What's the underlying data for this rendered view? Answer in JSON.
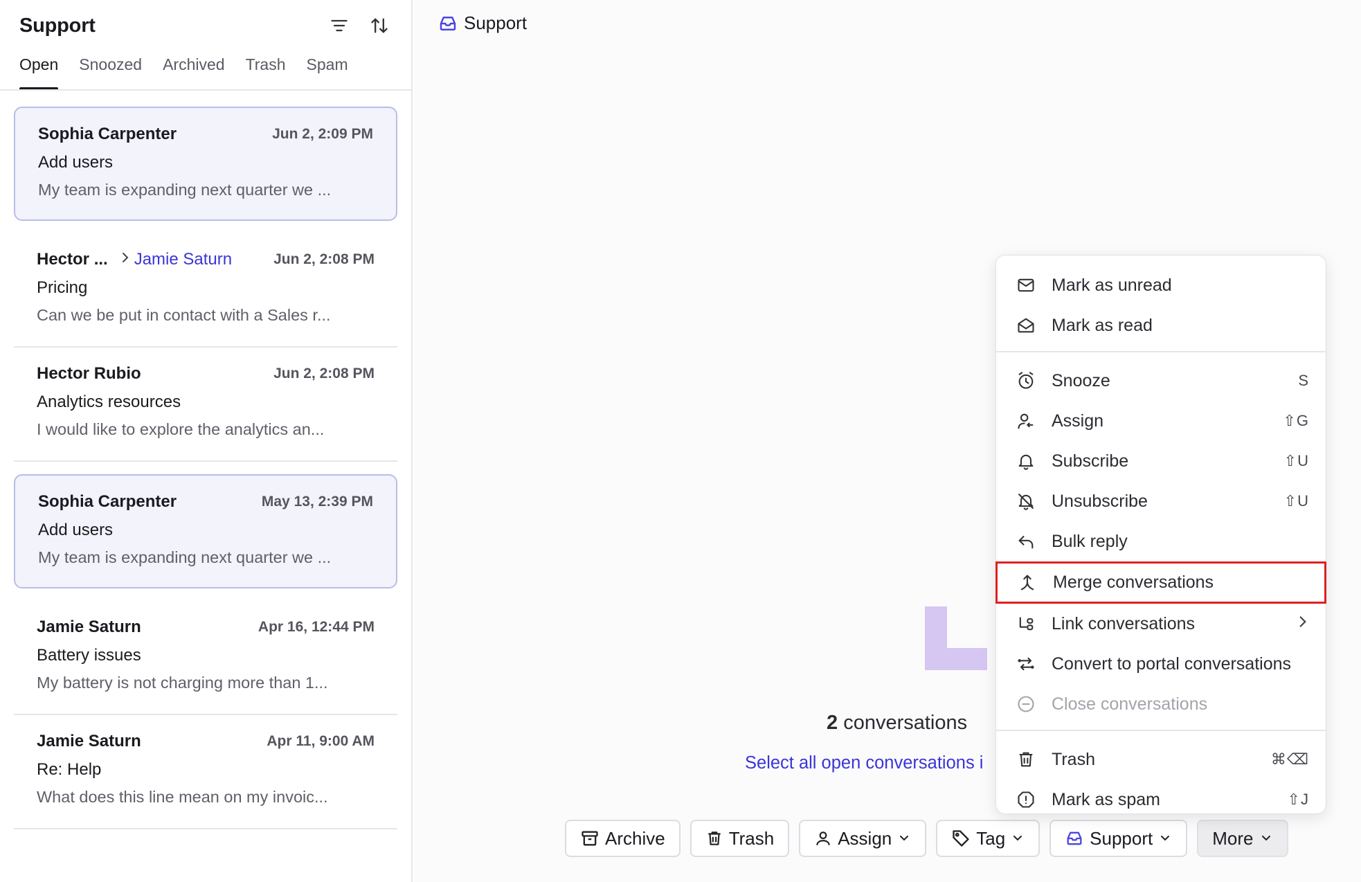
{
  "sidebar": {
    "title": "Support",
    "tabs": [
      {
        "label": "Open",
        "active": true
      },
      {
        "label": "Snoozed"
      },
      {
        "label": "Archived"
      },
      {
        "label": "Trash"
      },
      {
        "label": "Spam"
      }
    ],
    "conversations": [
      {
        "name": "Sophia Carpenter",
        "assignee": "",
        "date": "Jun 2, 2:09 PM",
        "subject": "Add users",
        "preview": "My team is expanding next quarter we ...",
        "selected": true
      },
      {
        "name": "Hector ...",
        "assignee": "Jamie Saturn",
        "date": "Jun 2, 2:08 PM",
        "subject": "Pricing",
        "preview": "Can we be put in contact with a Sales r...",
        "selected": false
      },
      {
        "name": "Hector Rubio",
        "assignee": "",
        "date": "Jun 2, 2:08 PM",
        "subject": "Analytics resources",
        "preview": "I would like to explore the analytics an...",
        "selected": false
      },
      {
        "name": "Sophia Carpenter",
        "assignee": "",
        "date": "May 13, 2:39 PM",
        "subject": "Add users",
        "preview": "My team is expanding next quarter we ...",
        "selected": true
      },
      {
        "name": "Jamie Saturn",
        "assignee": "",
        "date": "Apr 16, 12:44 PM",
        "subject": "Battery issues",
        "preview": "My battery is not charging more than 1...",
        "selected": false
      },
      {
        "name": "Jamie Saturn",
        "assignee": "",
        "date": "Apr 11, 9:00 AM",
        "subject": "Re: Help",
        "preview": "What does this line mean on my invoic...",
        "selected": false
      }
    ]
  },
  "main": {
    "title": "Support",
    "selection": {
      "count": "2",
      "text": " conversations se",
      "select_all": "Select all open conversations i"
    },
    "toolbar": {
      "archive": "Archive",
      "trash": "Trash",
      "assign": "Assign",
      "tag": "Tag",
      "inbox": "Support",
      "more": "More"
    }
  },
  "menu": {
    "items": [
      {
        "key": "mark_unread",
        "label": "Mark as unread",
        "shortcut": ""
      },
      {
        "key": "mark_read",
        "label": "Mark as read",
        "shortcut": ""
      },
      {
        "key": "snooze",
        "label": "Snooze",
        "shortcut": "S"
      },
      {
        "key": "assign",
        "label": "Assign",
        "shortcut": "⇧G"
      },
      {
        "key": "subscribe",
        "label": "Subscribe",
        "shortcut": "⇧U"
      },
      {
        "key": "unsubscribe",
        "label": "Unsubscribe",
        "shortcut": "⇧U"
      },
      {
        "key": "bulk_reply",
        "label": "Bulk reply",
        "shortcut": ""
      },
      {
        "key": "merge",
        "label": "Merge conversations",
        "shortcut": ""
      },
      {
        "key": "link",
        "label": "Link conversations",
        "shortcut": ""
      },
      {
        "key": "convert",
        "label": "Convert to portal conversations",
        "shortcut": ""
      },
      {
        "key": "close",
        "label": "Close conversations",
        "shortcut": ""
      },
      {
        "key": "trash",
        "label": "Trash",
        "shortcut": "⌘⌫"
      },
      {
        "key": "spam",
        "label": "Mark as spam",
        "shortcut": "⇧J"
      }
    ]
  },
  "colors": {
    "accent": "#3b35d6",
    "highlight": "#e02020",
    "illustration": "#d6c6f2"
  }
}
